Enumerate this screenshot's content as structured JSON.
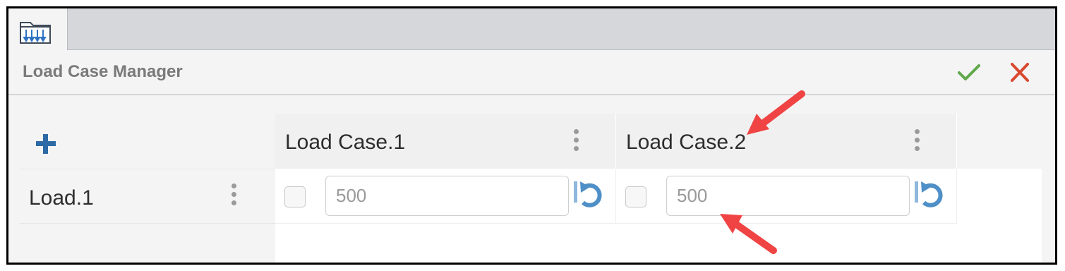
{
  "tab": {
    "icon": "load-case-folder-icon"
  },
  "header": {
    "title": "Load Case Manager",
    "ok_icon": "checkmark-icon",
    "cancel_icon": "close-icon"
  },
  "toolbar": {
    "add_icon": "plus-icon"
  },
  "columns": [
    {
      "label": "Load Case.1",
      "menu_icon": "kebab-menu-icon"
    },
    {
      "label": "Load Case.2",
      "menu_icon": "kebab-menu-icon"
    }
  ],
  "rows": [
    {
      "label": "Load.1",
      "menu_icon": "kebab-menu-icon",
      "cells": [
        {
          "checked": false,
          "value": "500",
          "reset_icon": "reset-icon"
        },
        {
          "checked": false,
          "value": "500",
          "reset_icon": "reset-icon"
        }
      ]
    }
  ],
  "colors": {
    "ok": "#5fa84a",
    "cancel": "#d9492f",
    "add": "#2e6aa6",
    "reset": "#4f8fc7",
    "annotation": "#f04444"
  }
}
